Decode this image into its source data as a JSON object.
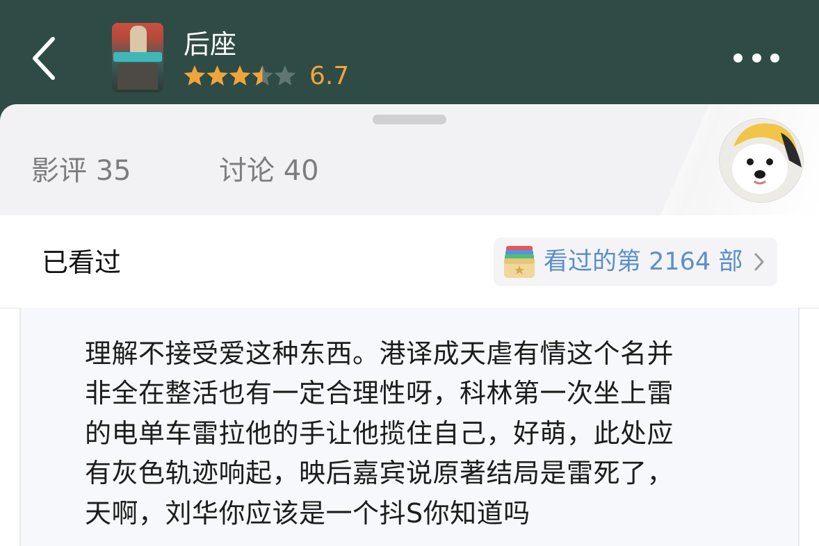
{
  "header": {
    "title": "后座",
    "rating": 3.5,
    "score": "6.7",
    "colors": {
      "background": "#2f4b45",
      "star": "#f0a53c",
      "star_empty": "#5f7672"
    }
  },
  "tabs": [
    {
      "label": "影评 35"
    },
    {
      "label": "讨论 40"
    }
  ],
  "seen": {
    "label": "已看过",
    "count_text": "看过的第 2164 部",
    "accent": "#5b8ec9"
  },
  "review": {
    "lines": [
      "理解不接受爱这种东西。港译成天虐有情这个名并",
      "非全在整活也有一定合理性呀，科林第一次坐上雷",
      "的电单车雷拉他的手让他揽住自己，好萌，此处应",
      "有灰色轨迹响起，映后嘉宾说原著结局是雷死了，",
      "天啊，刘华你应该是一个抖S你知道吗"
    ]
  }
}
